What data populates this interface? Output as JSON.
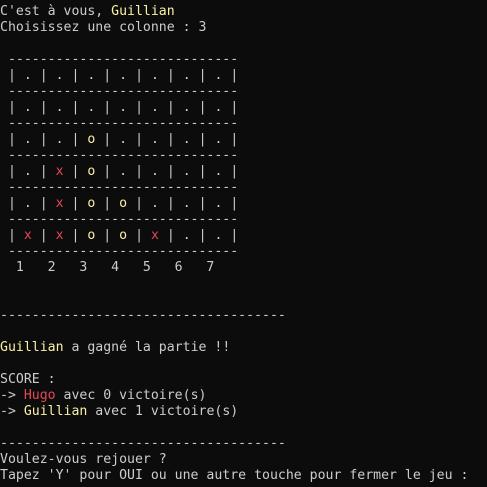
{
  "header": {
    "turn_prefix": "C'est à vous, ",
    "turn_player": "Guillian",
    "prompt": "Choisissez une colonne : 3"
  },
  "board": {
    "separator": " -----------------------------",
    "rows": [
      [
        ".",
        ".",
        ".",
        ".",
        ".",
        ".",
        "."
      ],
      [
        ".",
        ".",
        ".",
        ".",
        ".",
        ".",
        "."
      ],
      [
        ".",
        ".",
        "o",
        ".",
        ".",
        ".",
        "."
      ],
      [
        ".",
        "x",
        "o",
        ".",
        ".",
        ".",
        "."
      ],
      [
        ".",
        "x",
        "o",
        "o",
        ".",
        ".",
        "."
      ],
      [
        "x",
        "x",
        "o",
        "o",
        "x",
        ".",
        "."
      ]
    ],
    "column_labels": "  1   2   3   4   5   6   7"
  },
  "divider": "------------------------------------",
  "result": {
    "winner": "Guillian",
    "message": " a gagné la partie !!"
  },
  "score": {
    "title": "SCORE :",
    "entries": [
      {
        "arrow": "-> ",
        "name": "Hugo",
        "text": " avec 0 victoire(s)",
        "color": "#e74856"
      },
      {
        "arrow": "-> ",
        "name": "Guillian",
        "text": " avec 1 victoire(s)",
        "color": "#f9f1a5"
      }
    ]
  },
  "replay": {
    "question": "Voulez-vous rejouer ?",
    "instruction": "Tapez 'Y' pour OUI ou une autre touche pour fermer le jeu :"
  },
  "colors": {
    "background": "#0c0c0c",
    "text": "#cccccc",
    "player_yellow": "#f9f1a5",
    "player_red": "#e74856"
  }
}
